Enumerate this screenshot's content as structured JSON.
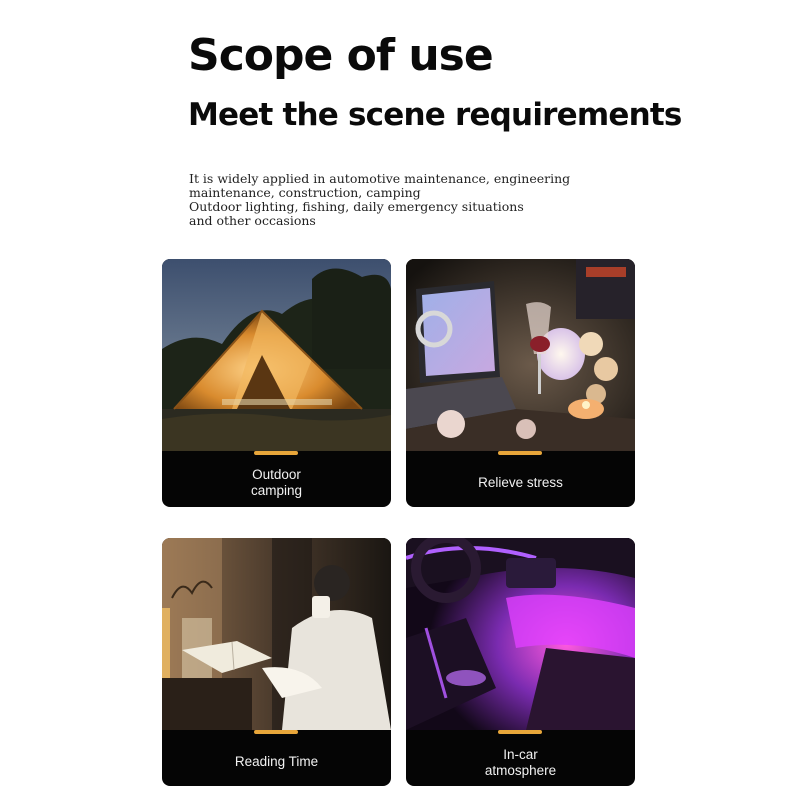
{
  "header": {
    "title": "Scope of use",
    "subtitle": "Meet the scene requirements"
  },
  "description": {
    "lines": [
      "It is widely applied in automotive maintenance, engineering",
      "maintenance, construction, camping",
      "Outdoor lighting, fishing, daily emergency situations",
      "and other occasions"
    ]
  },
  "cards": [
    {
      "label_lines": [
        "Outdoor",
        "camping"
      ]
    },
    {
      "label_lines": [
        "Relieve stress"
      ]
    },
    {
      "label_lines": [
        "Reading Time"
      ]
    },
    {
      "label_lines": [
        "In-car",
        "atmosphere"
      ]
    }
  ],
  "colors": {
    "accent": "#e8a63a",
    "card_background": "#050505",
    "label_text": "#f2f2f2"
  },
  "icons": [
    "tent-photo",
    "candle-laptop-photo",
    "reading-woman-photo",
    "car-interior-photo"
  ]
}
